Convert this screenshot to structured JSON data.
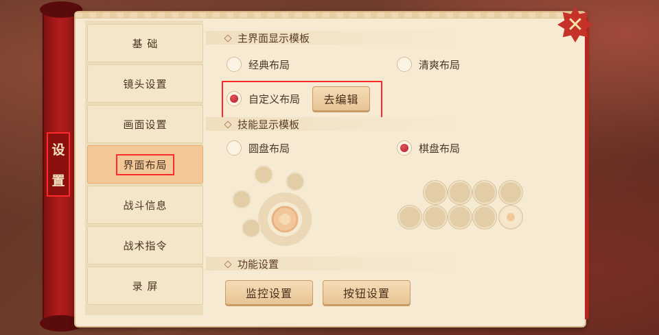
{
  "sidebar_title": [
    "设",
    "置"
  ],
  "tabs": [
    {
      "label": "基 础"
    },
    {
      "label": "镜头设置"
    },
    {
      "label": "画面设置"
    },
    {
      "label": "界面布局"
    },
    {
      "label": "战斗信息"
    },
    {
      "label": "战术指令"
    },
    {
      "label": "录 屏"
    }
  ],
  "active_tab": "界面布局",
  "main_template": {
    "title": "主界面显示模板",
    "options": [
      {
        "label": "经典布局",
        "selected": false
      },
      {
        "label": "清爽布局",
        "selected": false
      },
      {
        "label": "自定义布局",
        "selected": true
      }
    ],
    "edit_button": "去编辑"
  },
  "skill_template": {
    "title": "技能显示模板",
    "options": [
      {
        "label": "圆盘布局",
        "selected": false
      },
      {
        "label": "棋盘布局",
        "selected": true
      }
    ]
  },
  "function_settings": {
    "title": "功能设置",
    "buttons": [
      "监控设置",
      "按钮设置"
    ]
  },
  "icons": {
    "close": "close-icon",
    "section": "diamond-bullet-icon"
  },
  "colors": {
    "accent_red": "#b31c1c",
    "panel_bg": "#f6ead3",
    "active_tab": "#f3c898",
    "highlight": "#ff2a2a"
  }
}
